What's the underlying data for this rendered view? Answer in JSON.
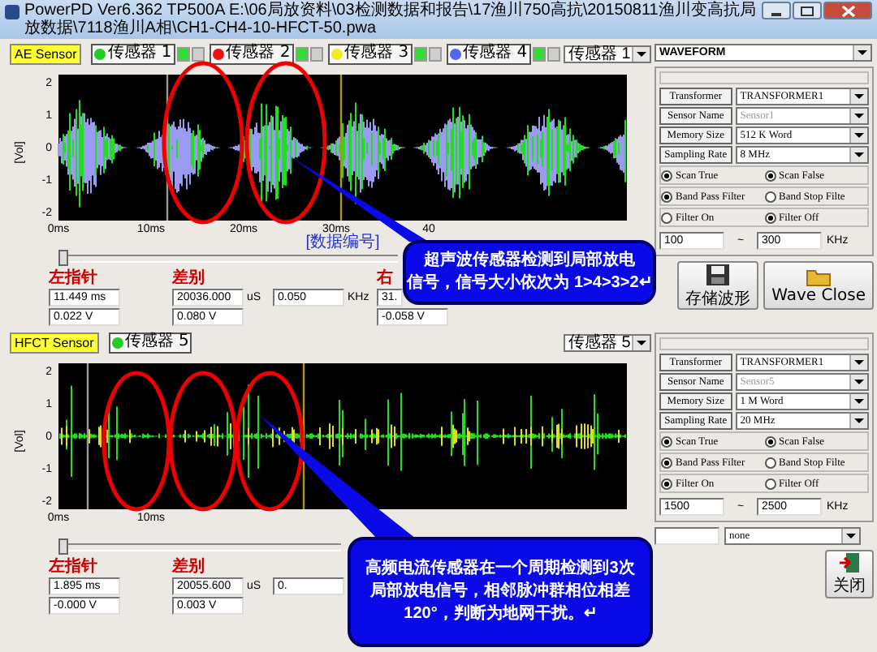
{
  "window": {
    "title": "PowerPD Ver6.362 TP500A E:\\06局放资料\\03检测数据和报告\\17渔川750高抗\\20150811渔川变高抗局放数据\\7118渔川A相\\CH1-CH4-10-HFCT-50.pwa"
  },
  "view_select": {
    "value": "WAVEFORM"
  },
  "panels": [
    {
      "sensor_label": "AE Sensor",
      "sensors": [
        {
          "label": "传感器 1",
          "color": "#22cc22",
          "channel_on": true,
          "trigger_on": false
        },
        {
          "label": "传感器 2",
          "color": "#ee1111",
          "channel_on": true,
          "trigger_on": false
        },
        {
          "label": "传感器 3",
          "color": "#eeee22",
          "channel_on": true,
          "trigger_on": false
        },
        {
          "label": "传感器 4",
          "color": "#5566ee",
          "channel_on": true,
          "trigger_on": false
        }
      ],
      "sensor_select": "传感器 1",
      "chart": {
        "kind": "ae",
        "y_title": "[Vol]",
        "y_ticks": [
          "2",
          "1",
          "0",
          "-1",
          "-2"
        ],
        "x_ticks": [
          "0ms",
          "10ms",
          "20ms",
          "30ms",
          "40"
        ],
        "x_title": "[数据编号]"
      },
      "readouts": {
        "left_title": "左指针",
        "left_time": "11.449 ms",
        "left_volt": "0.022 V",
        "diff_title": "差别",
        "diff_time": "20036.000",
        "diff_unit": "uS",
        "diff_volt": "0.080 V",
        "freq": "0.050",
        "freq_unit": "KHz",
        "right_title": "右",
        "right_time": "31.",
        "right_volt": "-0.058 V"
      },
      "settings": {
        "rows": [
          {
            "label": "Transformer",
            "value": "TRANSFORMER1",
            "disabled": false
          },
          {
            "label": "Sensor Name",
            "value": "Sensor1",
            "disabled": true
          },
          {
            "label": "Memory Size",
            "value": "512 K Word",
            "disabled": false
          },
          {
            "label": "Sampling Rate",
            "value": "8 MHz",
            "disabled": false
          }
        ],
        "radio_rows": [
          {
            "options": [
              {
                "label": "Scan True",
                "selected": true
              },
              {
                "label": "Scan False",
                "selected": true
              }
            ]
          },
          {
            "options": [
              {
                "label": "Band Pass Filter",
                "selected": true
              },
              {
                "label": "Band Stop Filte",
                "selected": false
              }
            ]
          },
          {
            "options": [
              {
                "label": "Filter On",
                "selected": false
              },
              {
                "label": "Filter Off",
                "selected": true
              }
            ]
          }
        ],
        "range_low": "100",
        "range_sep": "~",
        "range_high": "300",
        "range_unit": "KHz"
      },
      "buttons": [
        {
          "label": "存储波形",
          "kind": "save"
        },
        {
          "label": "Wave Close",
          "kind": "folder"
        }
      ],
      "callout": [
        "超声波传感器检测到局部放电",
        "信号，信号大小依次为 1>4>3>2↵"
      ]
    },
    {
      "sensor_label": "HFCT Sensor",
      "sensors": [
        {
          "label": "传感器 5",
          "color": "#22cc22"
        }
      ],
      "sensor_select": "传感器 5",
      "chart": {
        "kind": "hfct",
        "y_title": "[Vol]",
        "y_ticks": [
          "2",
          "1",
          "0",
          "-1",
          "-2"
        ],
        "x_ticks": [
          "0ms",
          "10ms"
        ]
      },
      "readouts": {
        "left_title": "左指针",
        "left_time": "1.895 ms",
        "left_volt": "-0.000 V",
        "diff_title": "差别",
        "diff_time": "20055.600",
        "diff_unit": "uS",
        "diff_volt": "0.003 V",
        "freq": "0."
      },
      "settings": {
        "rows": [
          {
            "label": "Transformer",
            "value": "TRANSFORMER1",
            "disabled": false
          },
          {
            "label": "Sensor Name",
            "value": "Sensor5",
            "disabled": true
          },
          {
            "label": "Memory Size",
            "value": "1 M Word",
            "disabled": false
          },
          {
            "label": "Sampling Rate",
            "value": "20 MHz",
            "disabled": false
          }
        ],
        "radio_rows": [
          {
            "options": [
              {
                "label": "Scan True",
                "selected": true
              },
              {
                "label": "Scan False",
                "selected": true
              }
            ]
          },
          {
            "options": [
              {
                "label": "Band Pass Filter",
                "selected": true
              },
              {
                "label": "Band Stop Filte",
                "selected": false
              }
            ]
          },
          {
            "options": [
              {
                "label": "Filter On",
                "selected": true
              },
              {
                "label": "Filter Off",
                "selected": false
              }
            ]
          }
        ],
        "range_low": "1500",
        "range_sep": "~",
        "range_high": "2500",
        "range_unit": "KHz"
      },
      "extra_select": "none",
      "buttons": [
        {
          "label": "关闭",
          "kind": "exit"
        }
      ],
      "callout": [
        "高频电流传感器在一个周期检测到3次",
        "局部放电信号，相邻脉冲群相位相差",
        "120°，判断为地网干扰。↵"
      ]
    }
  ]
}
